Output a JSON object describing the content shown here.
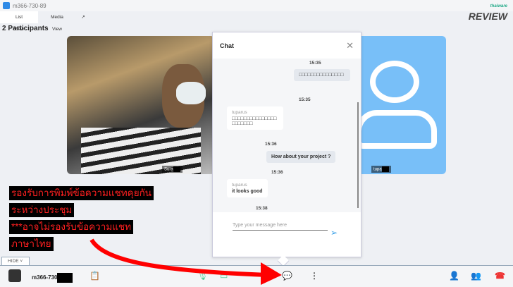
{
  "window": {
    "title": "m366-730-89"
  },
  "tabs": [
    {
      "label": "List View"
    },
    {
      "label": "Media View"
    }
  ],
  "participants_title": "2 Participants",
  "tiles": [
    {
      "name": "Sura"
    },
    {
      "name": "tupa"
    }
  ],
  "chat": {
    "title": "Chat",
    "placeholder": "Type your message here",
    "messages": [
      {
        "time": "15:35"
      },
      {
        "from": "me",
        "text": "□□□□□□□□□□□□□□□",
        "time": "15:35"
      },
      {
        "from": "tuparus",
        "text": "□□□□□□□□□□□□□□□□□□□□□□",
        "time": "15:36"
      },
      {
        "from": "me",
        "text": "How about your project ?",
        "time": "15:36"
      },
      {
        "from": "tuparus",
        "text": "it looks good",
        "time": "15:38"
      }
    ]
  },
  "overlay": {
    "lines": [
      "รองรับการพิมพ์ข้อความแชทคุยกัน",
      "ระหว่างประชุม",
      "***อาจไม่รองรับข้อความแชท",
      "ภาษาไทย"
    ],
    "color": "#ff2020"
  },
  "hide_label": "HIDE",
  "bottom": {
    "meeting_name": "m366-730"
  },
  "watermark": {
    "top": "thaiware",
    "main": "REVIEW"
  }
}
